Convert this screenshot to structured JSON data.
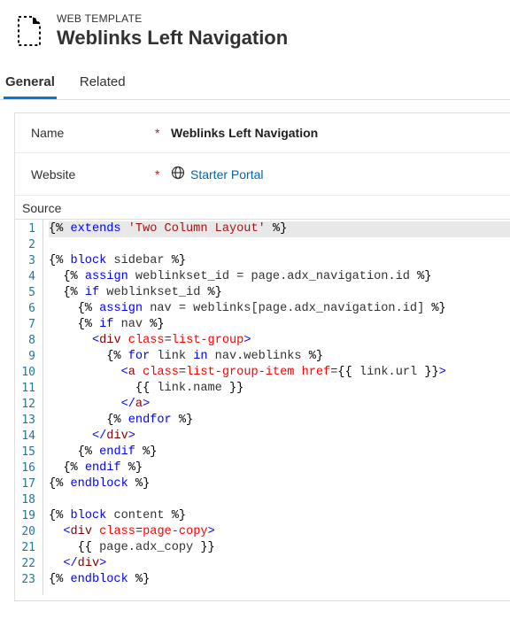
{
  "header": {
    "entity_label": "WEB TEMPLATE",
    "title": "Weblinks Left Navigation"
  },
  "tabs": {
    "general": "General",
    "related": "Related"
  },
  "fields": {
    "name_label": "Name",
    "name_value": "Weblinks Left Navigation",
    "website_label": "Website",
    "website_value": "Starter Portal"
  },
  "source": {
    "label": "Source",
    "lines": [
      [
        {
          "c": "hl",
          "seg": [
            {
              "t": "t-delim",
              "v": "{% "
            },
            {
              "t": "t-kw",
              "v": "extends"
            },
            {
              "t": "",
              "v": " "
            },
            {
              "t": "t-str",
              "v": "'Two Column Layout'"
            },
            {
              "t": "t-delim",
              "v": " %}"
            }
          ]
        }
      ],
      [
        {
          "seg": []
        }
      ],
      [
        {
          "seg": [
            {
              "t": "t-delim",
              "v": "{% "
            },
            {
              "t": "t-kw",
              "v": "block"
            },
            {
              "t": "",
              "v": " sidebar "
            },
            {
              "t": "t-delim",
              "v": "%}"
            }
          ]
        }
      ],
      [
        {
          "seg": [
            {
              "t": "",
              "v": "  "
            },
            {
              "t": "t-delim",
              "v": "{% "
            },
            {
              "t": "t-kw",
              "v": "assign"
            },
            {
              "t": "",
              "v": " weblinkset_id = page.adx_navigation.id "
            },
            {
              "t": "t-delim",
              "v": "%}"
            }
          ]
        }
      ],
      [
        {
          "seg": [
            {
              "t": "",
              "v": "  "
            },
            {
              "t": "t-delim",
              "v": "{% "
            },
            {
              "t": "t-kw",
              "v": "if"
            },
            {
              "t": "",
              "v": " weblinkset_id "
            },
            {
              "t": "t-delim",
              "v": "%}"
            }
          ]
        }
      ],
      [
        {
          "seg": [
            {
              "t": "",
              "v": "    "
            },
            {
              "t": "t-delim",
              "v": "{% "
            },
            {
              "t": "t-kw",
              "v": "assign"
            },
            {
              "t": "",
              "v": " nav = weblinks[page.adx_navigation.id] "
            },
            {
              "t": "t-delim",
              "v": "%}"
            }
          ]
        }
      ],
      [
        {
          "seg": [
            {
              "t": "",
              "v": "    "
            },
            {
              "t": "t-delim",
              "v": "{% "
            },
            {
              "t": "t-kw",
              "v": "if"
            },
            {
              "t": "",
              "v": " nav "
            },
            {
              "t": "t-delim",
              "v": "%}"
            }
          ]
        }
      ],
      [
        {
          "seg": [
            {
              "t": "",
              "v": "      "
            },
            {
              "t": "t-punc",
              "v": "<"
            },
            {
              "t": "t-tag",
              "v": "div"
            },
            {
              "t": "",
              "v": " "
            },
            {
              "t": "t-attr",
              "v": "class"
            },
            {
              "t": "",
              "v": "="
            },
            {
              "t": "t-val",
              "v": "list-group"
            },
            {
              "t": "t-punc",
              "v": ">"
            }
          ]
        }
      ],
      [
        {
          "seg": [
            {
              "t": "",
              "v": "        "
            },
            {
              "t": "t-delim",
              "v": "{% "
            },
            {
              "t": "t-kw",
              "v": "for"
            },
            {
              "t": "",
              "v": " link "
            },
            {
              "t": "t-kw",
              "v": "in"
            },
            {
              "t": "",
              "v": " nav.weblinks "
            },
            {
              "t": "t-delim",
              "v": "%}"
            }
          ]
        }
      ],
      [
        {
          "seg": [
            {
              "t": "",
              "v": "          "
            },
            {
              "t": "t-punc",
              "v": "<"
            },
            {
              "t": "t-tag",
              "v": "a"
            },
            {
              "t": "",
              "v": " "
            },
            {
              "t": "t-attr",
              "v": "class"
            },
            {
              "t": "",
              "v": "="
            },
            {
              "t": "t-val",
              "v": "list-group-item"
            },
            {
              "t": "",
              "v": " "
            },
            {
              "t": "t-attr",
              "v": "href"
            },
            {
              "t": "",
              "v": "="
            },
            {
              "t": "t-delim",
              "v": "{{"
            },
            {
              "t": "",
              "v": " link.url "
            },
            {
              "t": "t-delim",
              "v": "}}"
            },
            {
              "t": "t-punc",
              "v": ">"
            }
          ]
        }
      ],
      [
        {
          "seg": [
            {
              "t": "",
              "v": "            "
            },
            {
              "t": "t-delim",
              "v": "{{"
            },
            {
              "t": "",
              "v": " link.name "
            },
            {
              "t": "t-delim",
              "v": "}}"
            }
          ]
        }
      ],
      [
        {
          "seg": [
            {
              "t": "",
              "v": "          "
            },
            {
              "t": "t-punc",
              "v": "</"
            },
            {
              "t": "t-tag",
              "v": "a"
            },
            {
              "t": "t-punc",
              "v": ">"
            }
          ]
        }
      ],
      [
        {
          "seg": [
            {
              "t": "",
              "v": "        "
            },
            {
              "t": "t-delim",
              "v": "{% "
            },
            {
              "t": "t-kw",
              "v": "endfor"
            },
            {
              "t": "t-delim",
              "v": " %}"
            }
          ]
        }
      ],
      [
        {
          "seg": [
            {
              "t": "",
              "v": "      "
            },
            {
              "t": "t-punc",
              "v": "</"
            },
            {
              "t": "t-tag",
              "v": "div"
            },
            {
              "t": "t-punc",
              "v": ">"
            }
          ]
        }
      ],
      [
        {
          "seg": [
            {
              "t": "",
              "v": "    "
            },
            {
              "t": "t-delim",
              "v": "{% "
            },
            {
              "t": "t-kw",
              "v": "endif"
            },
            {
              "t": "t-delim",
              "v": " %}"
            }
          ]
        }
      ],
      [
        {
          "seg": [
            {
              "t": "",
              "v": "  "
            },
            {
              "t": "t-delim",
              "v": "{% "
            },
            {
              "t": "t-kw",
              "v": "endif"
            },
            {
              "t": "t-delim",
              "v": " %}"
            }
          ]
        }
      ],
      [
        {
          "seg": [
            {
              "t": "t-delim",
              "v": "{% "
            },
            {
              "t": "t-kw",
              "v": "endblock"
            },
            {
              "t": "t-delim",
              "v": " %}"
            }
          ]
        }
      ],
      [
        {
          "seg": []
        }
      ],
      [
        {
          "seg": [
            {
              "t": "t-delim",
              "v": "{% "
            },
            {
              "t": "t-kw",
              "v": "block"
            },
            {
              "t": "",
              "v": " content "
            },
            {
              "t": "t-delim",
              "v": "%}"
            }
          ]
        }
      ],
      [
        {
          "seg": [
            {
              "t": "",
              "v": "  "
            },
            {
              "t": "t-punc",
              "v": "<"
            },
            {
              "t": "t-tag",
              "v": "div"
            },
            {
              "t": "",
              "v": " "
            },
            {
              "t": "t-attr",
              "v": "class"
            },
            {
              "t": "",
              "v": "="
            },
            {
              "t": "t-val",
              "v": "page-copy"
            },
            {
              "t": "t-punc",
              "v": ">"
            }
          ]
        }
      ],
      [
        {
          "seg": [
            {
              "t": "",
              "v": "    "
            },
            {
              "t": "t-delim",
              "v": "{{"
            },
            {
              "t": "",
              "v": " page.adx_copy "
            },
            {
              "t": "t-delim",
              "v": "}}"
            }
          ]
        }
      ],
      [
        {
          "seg": [
            {
              "t": "",
              "v": "  "
            },
            {
              "t": "t-punc",
              "v": "</"
            },
            {
              "t": "t-tag",
              "v": "div"
            },
            {
              "t": "t-punc",
              "v": ">"
            }
          ]
        }
      ],
      [
        {
          "seg": [
            {
              "t": "t-delim",
              "v": "{% "
            },
            {
              "t": "t-kw",
              "v": "endblock"
            },
            {
              "t": "t-delim",
              "v": " %}"
            }
          ]
        }
      ]
    ]
  }
}
